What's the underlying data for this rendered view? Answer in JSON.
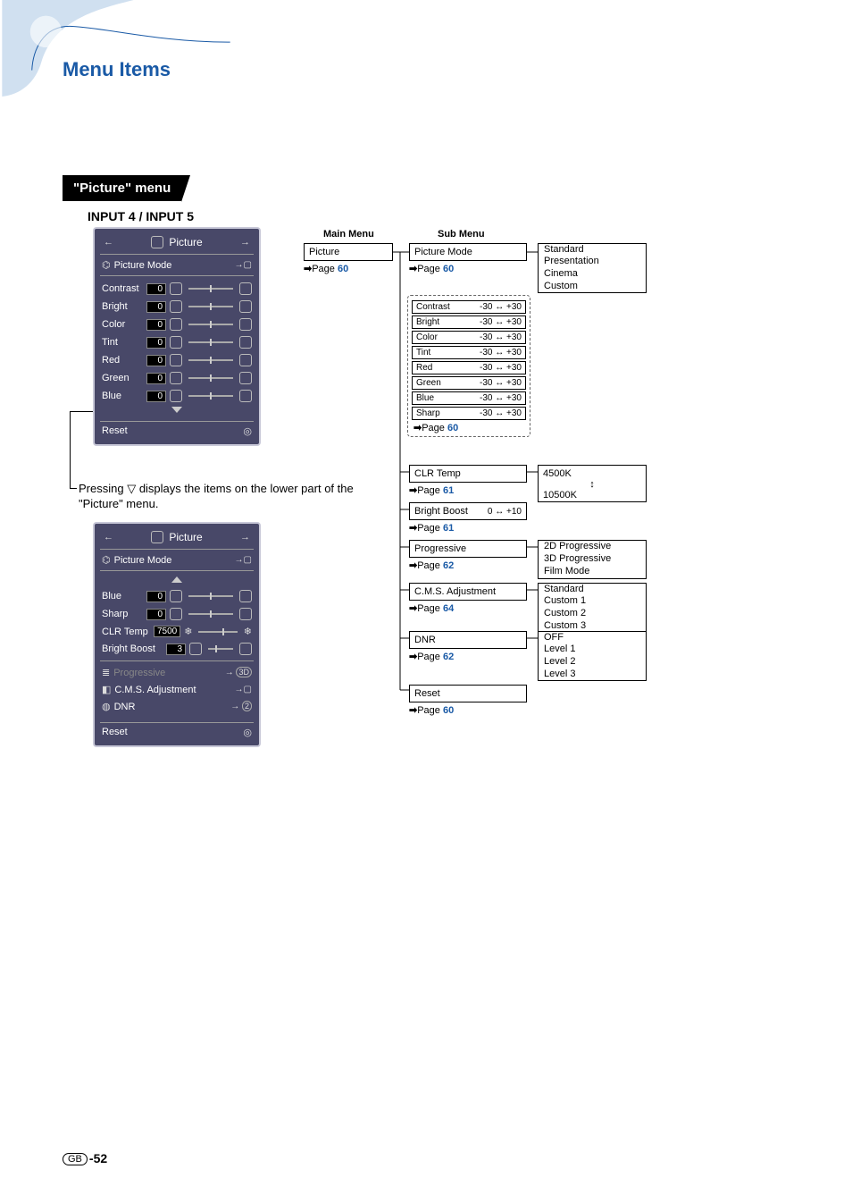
{
  "page_title": "Menu Items",
  "section_tab": "\"Picture\" menu",
  "input_label": "INPUT 4 / INPUT 5",
  "annotation": "Pressing ▽ displays the items on the lower part of the \"Picture\" menu.",
  "footer": {
    "region": "GB",
    "page": "-52"
  },
  "col_headers": {
    "main": "Main Menu",
    "sub": "Sub Menu"
  },
  "panel1": {
    "title": "Picture",
    "mode_label": "Picture Mode",
    "rows": [
      {
        "label": "Contrast",
        "value": "0"
      },
      {
        "label": "Bright",
        "value": "0"
      },
      {
        "label": "Color",
        "value": "0"
      },
      {
        "label": "Tint",
        "value": "0"
      },
      {
        "label": "Red",
        "value": "0"
      },
      {
        "label": "Green",
        "value": "0"
      },
      {
        "label": "Blue",
        "value": "0"
      }
    ],
    "reset": "Reset"
  },
  "panel2": {
    "title": "Picture",
    "mode_label": "Picture Mode",
    "rows_top": [
      {
        "label": "Blue",
        "value": "0"
      },
      {
        "label": "Sharp",
        "value": "0"
      }
    ],
    "clr_row": {
      "label": "CLR Temp",
      "value": "7500"
    },
    "bb_row": {
      "label": "Bright Boost",
      "value": "3"
    },
    "progressive": "Progressive",
    "prog_badge": "3D",
    "cms": "C.M.S. Adjustment",
    "dnr": "DNR",
    "dnr_badge": "2",
    "reset": "Reset"
  },
  "tree": {
    "picture_label": "Picture",
    "picture_page": "60",
    "picture_mode": {
      "label": "Picture Mode",
      "page": "60"
    },
    "picture_mode_opts": [
      "Standard",
      "Presentation",
      "Cinema",
      "Custom"
    ],
    "sliders": [
      {
        "label": "Contrast",
        "range": "-30 ↔ +30"
      },
      {
        "label": "Bright",
        "range": "-30 ↔ +30"
      },
      {
        "label": "Color",
        "range": "-30 ↔ +30"
      },
      {
        "label": "Tint",
        "range": "-30 ↔ +30"
      },
      {
        "label": "Red",
        "range": "-30 ↔ +30"
      },
      {
        "label": "Green",
        "range": "-30 ↔ +30"
      },
      {
        "label": "Blue",
        "range": "-30 ↔ +30"
      },
      {
        "label": "Sharp",
        "range": "-30 ↔ +30"
      }
    ],
    "sliders_page": "60",
    "clr_temp": {
      "label": "CLR Temp",
      "page": "61",
      "opts": [
        "4500K",
        "10500K"
      ]
    },
    "bright_boost": {
      "label": "Bright Boost",
      "range": "0 ↔ +10",
      "page": "61"
    },
    "progressive": {
      "label": "Progressive",
      "page": "62",
      "opts": [
        "2D Progressive",
        "3D Progressive",
        "Film Mode"
      ]
    },
    "cms": {
      "label": "C.M.S. Adjustment",
      "page": "64",
      "opts": [
        "Standard",
        "Custom 1",
        "Custom 2",
        "Custom 3"
      ]
    },
    "dnr": {
      "label": "DNR",
      "page": "62",
      "opts": [
        "OFF",
        "Level 1",
        "Level 2",
        "Level 3"
      ]
    },
    "reset": {
      "label": "Reset",
      "page": "60"
    }
  },
  "glyphs": {
    "arrow_r": "→",
    "arrow_l": "←",
    "arrow_plink": "➡",
    "updown": "↕",
    "circ": "◎",
    "tri_down": "▽",
    "tri_up": "△"
  }
}
